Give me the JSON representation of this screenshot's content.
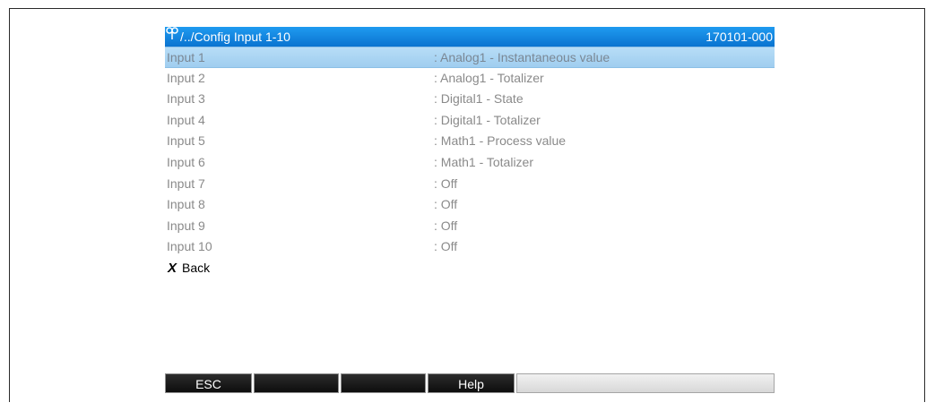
{
  "header": {
    "path": "/../Config Input 1-10",
    "device_id": "170101-000"
  },
  "inputs": [
    {
      "label": "Input 1",
      "value": ": Analog1 - Instantaneous value",
      "selected": true
    },
    {
      "label": "Input 2",
      "value": ": Analog1 - Totalizer"
    },
    {
      "label": "Input 3",
      "value": ": Digital1 - State"
    },
    {
      "label": "Input 4",
      "value": ": Digital1 - Totalizer"
    },
    {
      "label": "Input 5",
      "value": ": Math1 - Process value"
    },
    {
      "label": "Input 6",
      "value": ": Math1 - Totalizer"
    },
    {
      "label": "Input 7",
      "value": ": Off"
    },
    {
      "label": "Input 8",
      "value": ": Off"
    },
    {
      "label": "Input 9",
      "value": ": Off"
    },
    {
      "label": "Input 10",
      "value": ": Off"
    }
  ],
  "back": {
    "icon": "x-icon",
    "label": "Back"
  },
  "softkeys": [
    "ESC",
    "",
    "",
    "Help"
  ],
  "colors": {
    "titlebar": "#0a73d0",
    "selection": "#b7ddf7",
    "text": "#8a8a8a"
  }
}
